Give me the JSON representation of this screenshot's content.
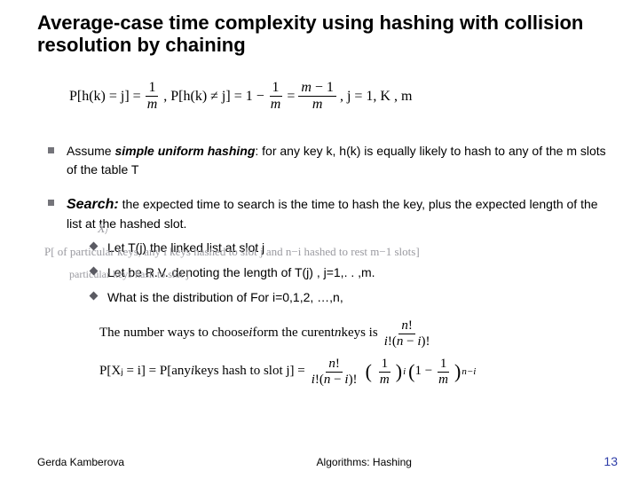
{
  "title": "Average-case time complexity using hashing with collision resolution by chaining",
  "eq": {
    "p1": "P[h(k) = j] =",
    "p2": ", P[h(k) ≠ j] = 1 −",
    "p3": "=",
    "p4": ", j = 1, K , m"
  },
  "bullet1": {
    "pre": "Assume ",
    "strong": "simple uniform hashing",
    "post": ":  for any key k, h(k) is equally likely to hash to any of the m slots of the table T"
  },
  "bullet2": {
    "strong": "Search:",
    "post": " the expected time to search is the time to hash the key, plus the expected length of the list at the hashed slot."
  },
  "sub": {
    "a": "Let T(j) the linked list at slot j",
    "b_pre": "Let           be R.V.  denoting the length of T(j) , j=1,. . ,m.",
    "c_pre": "What is the distribution of              For i=0,1,2, …,n,"
  },
  "ghost": {
    "xj": "Xⱼ",
    "g2": "P[ of  particular keys, any i keys hashed to slot j and n−i hashed to rest m−1 slots]",
    "g3": "particular keys hash to slot j"
  },
  "math": {
    "row1a": "The number ways to choose ",
    "row1b": " form the curent ",
    "row1c": " keys is ",
    "row2a": "P[Xⱼ = i] = P[any ",
    "row2b": " keys hash to slot j] = "
  },
  "footer": {
    "author": "Gerda Kamberova",
    "center": "Algorithms: Hashing",
    "page": "13"
  }
}
